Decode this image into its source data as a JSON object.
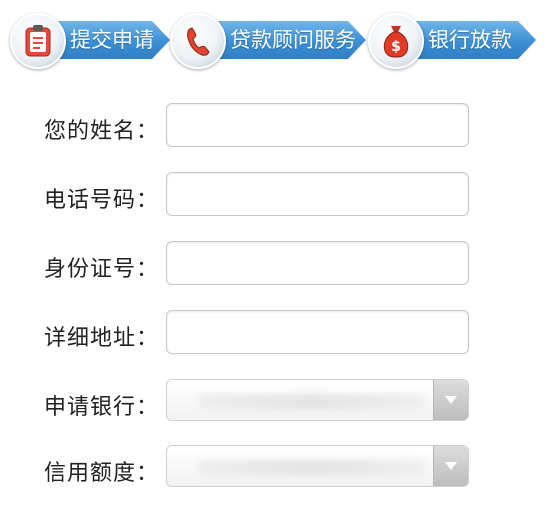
{
  "steps": [
    {
      "label": "提交申请",
      "icon": "clipboard-icon"
    },
    {
      "label": "贷款顾问服务",
      "icon": "phone-icon"
    },
    {
      "label": "银行放款",
      "icon": "money-bag-icon"
    }
  ],
  "form": {
    "name": {
      "label": "您的姓名：",
      "value": ""
    },
    "phone": {
      "label": "电话号码：",
      "value": ""
    },
    "id_number": {
      "label": "身份证号：",
      "value": ""
    },
    "address": {
      "label": "详细地址：",
      "value": ""
    },
    "bank": {
      "label": "申请银行：",
      "selected": ""
    },
    "credit_limit": {
      "label": "信用额度：",
      "selected": ""
    }
  },
  "colors": {
    "arrow": "#3c8fd4",
    "label_text": "#222222"
  }
}
